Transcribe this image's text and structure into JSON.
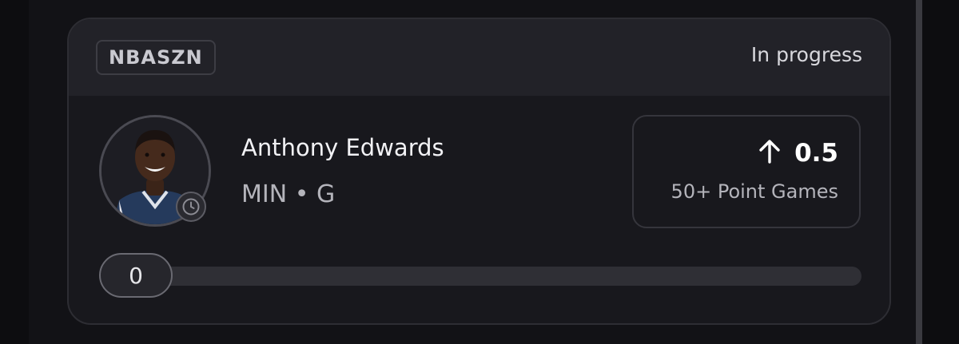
{
  "card": {
    "league": "NBASZN",
    "status": "In progress"
  },
  "player": {
    "name": "Anthony Edwards",
    "team_position": "MIN • G",
    "avatar_icon": "player-headshot",
    "status_icon": "clock-icon"
  },
  "pick": {
    "direction_icon": "arrow-up-icon",
    "line": "0.5",
    "market": "50+ Point Games"
  },
  "progress": {
    "current_label": "0",
    "current_value": 0,
    "target_value": 0.5
  },
  "colors": {
    "background": "#121216",
    "card": "#18181d",
    "header": "#222228",
    "text_primary": "#f2f2f5",
    "text_secondary": "#b4b4bb"
  }
}
